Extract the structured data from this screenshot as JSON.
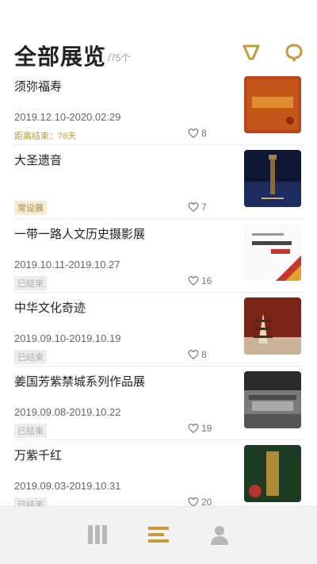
{
  "header": {
    "title": "全部展览",
    "count": "/75个",
    "filter_icon": "filter-funnel",
    "search_icon": "search"
  },
  "colors": {
    "accent": "#c79a3b",
    "ended_badge": "#ececec"
  },
  "exhibitions": [
    {
      "title": "须弥福寿",
      "date": "2019.12.10-2020.02.29",
      "badge": "距离结束：78天",
      "badge_type": "remaining",
      "likes": "8",
      "thumb_colors": [
        "#c5561a",
        "#a2340f"
      ]
    },
    {
      "title": "大圣遗音",
      "date": "",
      "badge": "常设展",
      "badge_type": "permanent",
      "likes": "7",
      "thumb_colors": [
        "#0f1633",
        "#23306a"
      ]
    },
    {
      "title": "一带一路人文历史摄影展",
      "date": "2019.10.11-2019.10.27",
      "badge": "已结束",
      "badge_type": "ended",
      "likes": "16",
      "thumb_colors": [
        "#ffffff",
        "#c0392b"
      ]
    },
    {
      "title": "中华文化奇迹",
      "date": "2019.09.10-2019.10.19",
      "badge": "已结束",
      "badge_type": "ended",
      "likes": "8",
      "thumb_colors": [
        "#7a2418",
        "#d8c7b0"
      ]
    },
    {
      "title": "姜国芳紫禁城系列作品展",
      "date": "2019.09.08-2019.10.22",
      "badge": "已结束",
      "badge_type": "ended",
      "likes": "19",
      "thumb_colors": [
        "#333333",
        "#888888"
      ]
    },
    {
      "title": "万紫千红",
      "date": "2019.09.03-2019.10.31",
      "badge": "已结束",
      "badge_type": "ended",
      "likes": "20",
      "thumb_colors": [
        "#1e3b23",
        "#c79a3b"
      ]
    }
  ],
  "bottom_nav": {
    "tabs": [
      {
        "name": "home",
        "icon": "columns-icon"
      },
      {
        "name": "list",
        "icon": "list-icon",
        "active": true
      },
      {
        "name": "me",
        "icon": "person-icon"
      }
    ]
  }
}
